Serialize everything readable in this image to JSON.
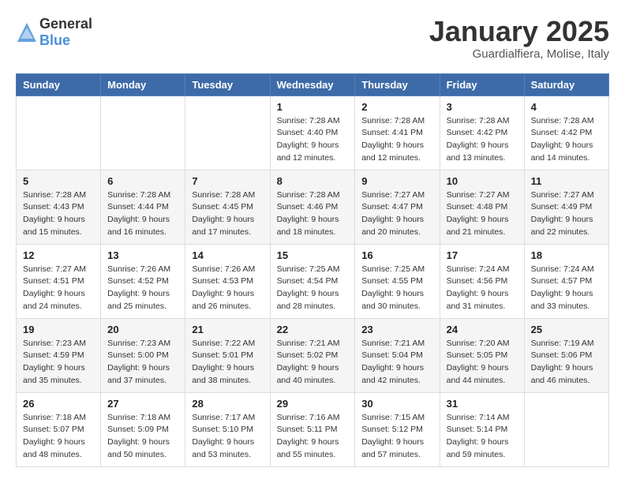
{
  "header": {
    "logo_general": "General",
    "logo_blue": "Blue",
    "month": "January 2025",
    "location": "Guardialfiera, Molise, Italy"
  },
  "weekdays": [
    "Sunday",
    "Monday",
    "Tuesday",
    "Wednesday",
    "Thursday",
    "Friday",
    "Saturday"
  ],
  "weeks": [
    [
      {
        "day": "",
        "info": ""
      },
      {
        "day": "",
        "info": ""
      },
      {
        "day": "",
        "info": ""
      },
      {
        "day": "1",
        "info": "Sunrise: 7:28 AM\nSunset: 4:40 PM\nDaylight: 9 hours\nand 12 minutes."
      },
      {
        "day": "2",
        "info": "Sunrise: 7:28 AM\nSunset: 4:41 PM\nDaylight: 9 hours\nand 12 minutes."
      },
      {
        "day": "3",
        "info": "Sunrise: 7:28 AM\nSunset: 4:42 PM\nDaylight: 9 hours\nand 13 minutes."
      },
      {
        "day": "4",
        "info": "Sunrise: 7:28 AM\nSunset: 4:42 PM\nDaylight: 9 hours\nand 14 minutes."
      }
    ],
    [
      {
        "day": "5",
        "info": "Sunrise: 7:28 AM\nSunset: 4:43 PM\nDaylight: 9 hours\nand 15 minutes."
      },
      {
        "day": "6",
        "info": "Sunrise: 7:28 AM\nSunset: 4:44 PM\nDaylight: 9 hours\nand 16 minutes."
      },
      {
        "day": "7",
        "info": "Sunrise: 7:28 AM\nSunset: 4:45 PM\nDaylight: 9 hours\nand 17 minutes."
      },
      {
        "day": "8",
        "info": "Sunrise: 7:28 AM\nSunset: 4:46 PM\nDaylight: 9 hours\nand 18 minutes."
      },
      {
        "day": "9",
        "info": "Sunrise: 7:27 AM\nSunset: 4:47 PM\nDaylight: 9 hours\nand 20 minutes."
      },
      {
        "day": "10",
        "info": "Sunrise: 7:27 AM\nSunset: 4:48 PM\nDaylight: 9 hours\nand 21 minutes."
      },
      {
        "day": "11",
        "info": "Sunrise: 7:27 AM\nSunset: 4:49 PM\nDaylight: 9 hours\nand 22 minutes."
      }
    ],
    [
      {
        "day": "12",
        "info": "Sunrise: 7:27 AM\nSunset: 4:51 PM\nDaylight: 9 hours\nand 24 minutes."
      },
      {
        "day": "13",
        "info": "Sunrise: 7:26 AM\nSunset: 4:52 PM\nDaylight: 9 hours\nand 25 minutes."
      },
      {
        "day": "14",
        "info": "Sunrise: 7:26 AM\nSunset: 4:53 PM\nDaylight: 9 hours\nand 26 minutes."
      },
      {
        "day": "15",
        "info": "Sunrise: 7:25 AM\nSunset: 4:54 PM\nDaylight: 9 hours\nand 28 minutes."
      },
      {
        "day": "16",
        "info": "Sunrise: 7:25 AM\nSunset: 4:55 PM\nDaylight: 9 hours\nand 30 minutes."
      },
      {
        "day": "17",
        "info": "Sunrise: 7:24 AM\nSunset: 4:56 PM\nDaylight: 9 hours\nand 31 minutes."
      },
      {
        "day": "18",
        "info": "Sunrise: 7:24 AM\nSunset: 4:57 PM\nDaylight: 9 hours\nand 33 minutes."
      }
    ],
    [
      {
        "day": "19",
        "info": "Sunrise: 7:23 AM\nSunset: 4:59 PM\nDaylight: 9 hours\nand 35 minutes."
      },
      {
        "day": "20",
        "info": "Sunrise: 7:23 AM\nSunset: 5:00 PM\nDaylight: 9 hours\nand 37 minutes."
      },
      {
        "day": "21",
        "info": "Sunrise: 7:22 AM\nSunset: 5:01 PM\nDaylight: 9 hours\nand 38 minutes."
      },
      {
        "day": "22",
        "info": "Sunrise: 7:21 AM\nSunset: 5:02 PM\nDaylight: 9 hours\nand 40 minutes."
      },
      {
        "day": "23",
        "info": "Sunrise: 7:21 AM\nSunset: 5:04 PM\nDaylight: 9 hours\nand 42 minutes."
      },
      {
        "day": "24",
        "info": "Sunrise: 7:20 AM\nSunset: 5:05 PM\nDaylight: 9 hours\nand 44 minutes."
      },
      {
        "day": "25",
        "info": "Sunrise: 7:19 AM\nSunset: 5:06 PM\nDaylight: 9 hours\nand 46 minutes."
      }
    ],
    [
      {
        "day": "26",
        "info": "Sunrise: 7:18 AM\nSunset: 5:07 PM\nDaylight: 9 hours\nand 48 minutes."
      },
      {
        "day": "27",
        "info": "Sunrise: 7:18 AM\nSunset: 5:09 PM\nDaylight: 9 hours\nand 50 minutes."
      },
      {
        "day": "28",
        "info": "Sunrise: 7:17 AM\nSunset: 5:10 PM\nDaylight: 9 hours\nand 53 minutes."
      },
      {
        "day": "29",
        "info": "Sunrise: 7:16 AM\nSunset: 5:11 PM\nDaylight: 9 hours\nand 55 minutes."
      },
      {
        "day": "30",
        "info": "Sunrise: 7:15 AM\nSunset: 5:12 PM\nDaylight: 9 hours\nand 57 minutes."
      },
      {
        "day": "31",
        "info": "Sunrise: 7:14 AM\nSunset: 5:14 PM\nDaylight: 9 hours\nand 59 minutes."
      },
      {
        "day": "",
        "info": ""
      }
    ]
  ]
}
